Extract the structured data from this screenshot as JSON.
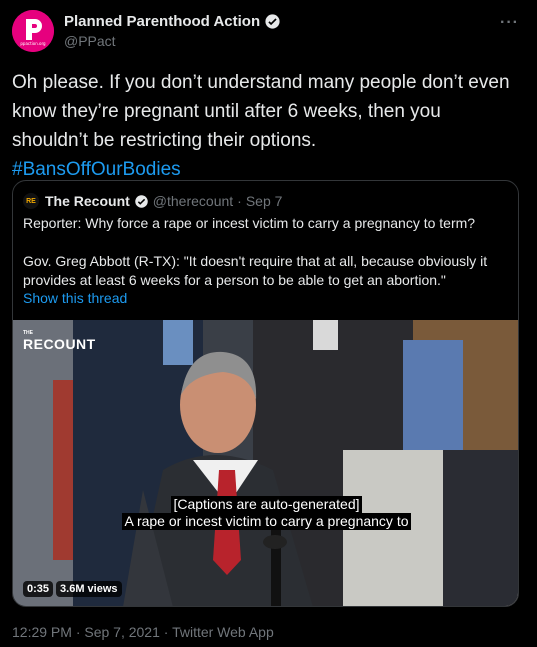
{
  "author": {
    "display_name": "Planned Parenthood Action",
    "handle": "@PPact",
    "avatar_caption": "ppaction.org",
    "verified_icon": "verified-badge-icon",
    "more_label": "···"
  },
  "tweet": {
    "text": "Oh please. If you don’t understand many people don’t even know they’re pregnant until after 6 weeks, then you shouldn’t be restricting their options.",
    "hashtag": "#BansOffOurBodies"
  },
  "quote": {
    "logo_text": "RE",
    "name": "The Recount",
    "handle": "@therecount",
    "separator": "·",
    "date": "Sep 7",
    "paragraph1": "Reporter: Why force a rape or incest victim to carry a pregnancy to term?",
    "paragraph2": "Gov. Greg Abbott (R-TX): \"It doesn't require that at all, because obviously it provides at least 6 weeks for a person to be able to get an abortion.\"",
    "show_thread": "Show this thread"
  },
  "video": {
    "watermark_small": "THE",
    "watermark": "RECOUNT",
    "caption_line1": "[Captions are auto-generated]",
    "caption_line2": "A rape or incest victim to carry a pregnancy to",
    "duration": "0:35",
    "views": "3.6M views"
  },
  "footer": {
    "timestamp": "12:29 PM · Sep 7, 2021 · Twitter Web App"
  },
  "colors": {
    "background": "#000000",
    "accent": "#1d9bf0",
    "muted": "#71767b",
    "brand_pink": "#e6007e"
  }
}
